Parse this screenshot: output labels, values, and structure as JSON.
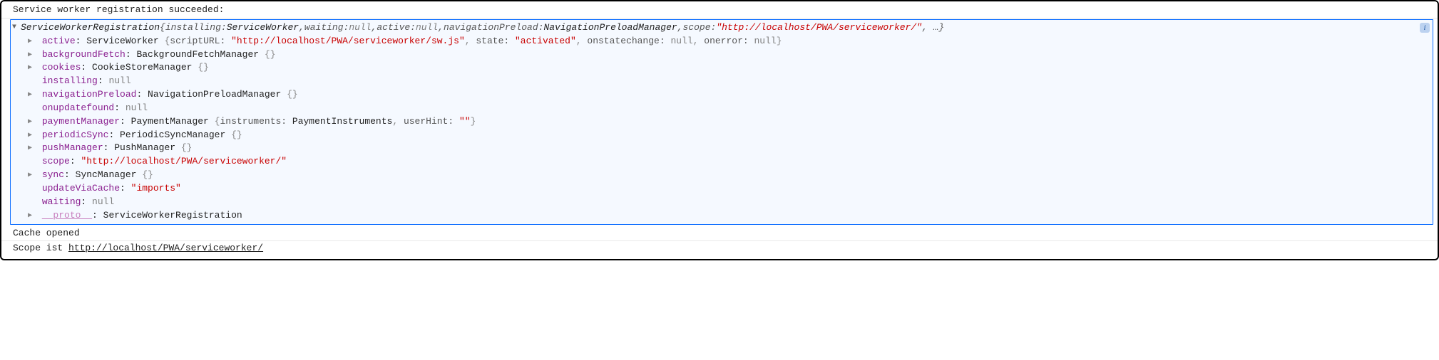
{
  "log1": "Service worker registration succeeded:",
  "header": {
    "ctor": "ServiceWorkerRegistration",
    "open": " {",
    "k_installing": "installing: ",
    "v_installing": "ServiceWorker",
    "sep": ", ",
    "k_waiting": "waiting: ",
    "v_waiting": "null",
    "k_active": "active: ",
    "v_active": "null",
    "k_nav": "navigationPreload: ",
    "v_nav": "NavigationPreloadManager",
    "k_scope": "scope: ",
    "v_scope": "\"http://localhost/PWA/serviceworker/\"",
    "close": ", …}"
  },
  "props": {
    "active": {
      "key": "active",
      "ctor": "ServiceWorker ",
      "open": "{",
      "k1": "scriptURL: ",
      "v1": "\"http://localhost/PWA/serviceworker/sw.js\"",
      "sep": ", ",
      "k2": "state: ",
      "v2": "\"activated\"",
      "k3": "onstatechange: ",
      "v3": "null",
      "k4": "onerror: ",
      "v4": "null",
      "close": "}"
    },
    "backgroundFetch": {
      "key": "backgroundFetch",
      "ctor": "BackgroundFetchManager ",
      "rest": "{}"
    },
    "cookies": {
      "key": "cookies",
      "ctor": "CookieStoreManager ",
      "rest": "{}"
    },
    "installing": {
      "key": "installing",
      "val": "null"
    },
    "navigationPreload": {
      "key": "navigationPreload",
      "ctor": "NavigationPreloadManager ",
      "rest": "{}"
    },
    "onupdatefound": {
      "key": "onupdatefound",
      "val": "null"
    },
    "paymentManager": {
      "key": "paymentManager",
      "ctor": "PaymentManager ",
      "open": "{",
      "k1": "instruments: ",
      "v1": "PaymentInstruments",
      "sep": ", ",
      "k2": "userHint: ",
      "v2": "\"\"",
      "close": "}"
    },
    "periodicSync": {
      "key": "periodicSync",
      "ctor": "PeriodicSyncManager ",
      "rest": "{}"
    },
    "pushManager": {
      "key": "pushManager",
      "ctor": "PushManager ",
      "rest": "{}"
    },
    "scope": {
      "key": "scope",
      "val": "\"http://localhost/PWA/serviceworker/\""
    },
    "sync": {
      "key": "sync",
      "ctor": "SyncManager ",
      "rest": "{}"
    },
    "updateViaCache": {
      "key": "updateViaCache",
      "val": "\"imports\""
    },
    "waiting": {
      "key": "waiting",
      "val": "null"
    },
    "proto": {
      "key": "__proto__",
      "val": "ServiceWorkerRegistration"
    }
  },
  "log2": "Cache opened",
  "log3_prefix": "Scope ist ",
  "log3_url": "http://localhost/PWA/serviceworker/"
}
